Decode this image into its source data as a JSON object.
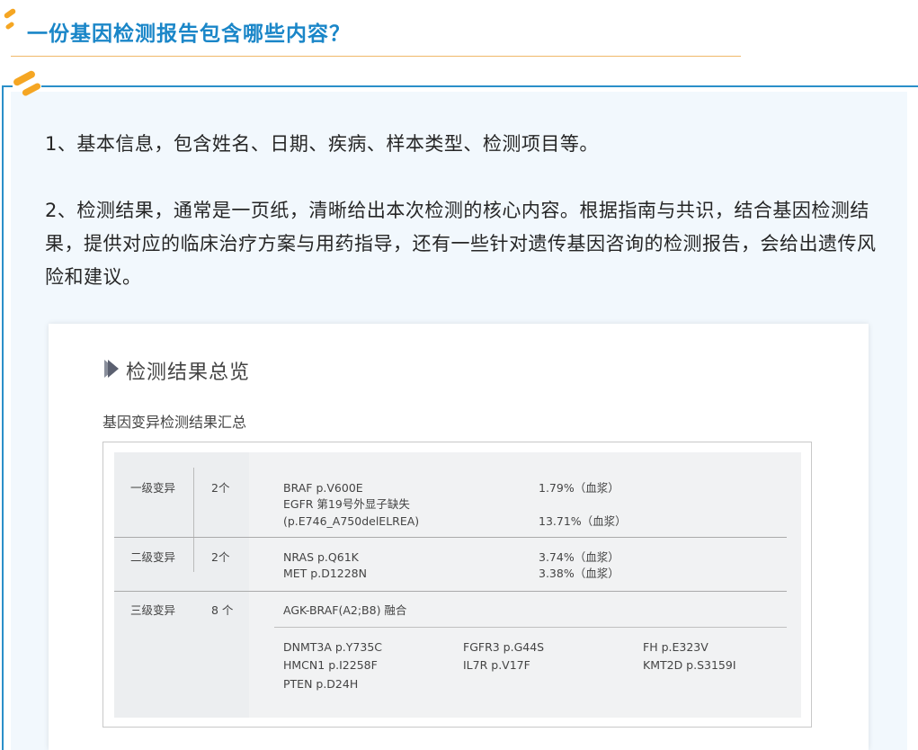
{
  "header": {
    "title": "一份基因检测报告包含哪些内容？"
  },
  "content": {
    "p1": "1、基本信息，包含姓名、日期、疾病、样本类型、检测项目等。",
    "p2": "2、检测结果，通常是一页纸，清晰给出本次检测的核心内容。根据指南与共识，结合基因检测结果，提供对应的临床治疗方案与用药指导，还有一些针对遗传基因咨询的检测报告，会给出遗传风险和建议。"
  },
  "report": {
    "title": "检测结果总览",
    "subtitle": "基因变异检测结果汇总",
    "rows": [
      {
        "level": "一级变异",
        "count": "2个",
        "variants": [
          "BRAF p.V600E",
          "EGFR 第19号外显子缺失",
          "(p.E746_A750delELREA)"
        ],
        "freqs": [
          "1.79%（血浆）",
          "13.71%（血浆）"
        ]
      },
      {
        "level": "二级变异",
        "count": "2个",
        "variants": [
          "NRAS p.Q61K",
          "MET p.D1228N"
        ],
        "freqs": [
          "3.74%（血浆）",
          "3.38%（血浆）"
        ]
      },
      {
        "level": "三级变异",
        "count": "8 个",
        "fusion": "AGK-BRAF(A2;B8) 融合",
        "col1": [
          "DNMT3A p.Y735C",
          "HMCN1 p.I2258F",
          "PTEN p.D24H"
        ],
        "col2": [
          "FGFR3 p.G44S",
          "IL7R p.V17F"
        ],
        "col3": [
          "FH p.E323V",
          "KMT2D p.S3159I"
        ]
      }
    ]
  },
  "colors": {
    "title_blue": "#1a86c8",
    "accent_orange": "#f5a623",
    "border_blue": "#2a8fc9",
    "box_bg": "#f2f8fd"
  }
}
